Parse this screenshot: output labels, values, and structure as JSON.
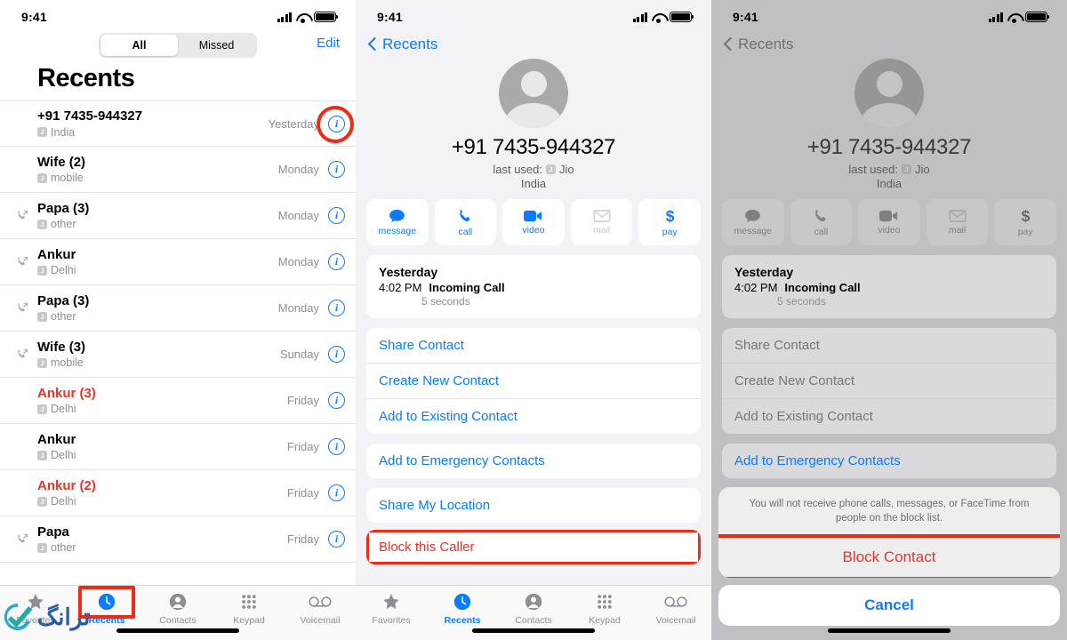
{
  "statusbar": {
    "time": "9:41",
    "signal_icon": "cellular-bars-icon",
    "wifi_icon": "wifi-icon",
    "battery_icon": "battery-icon"
  },
  "colors": {
    "accent_blue": "#0a7cff",
    "destructive_red": "#e8352a",
    "highlight_red": "#ee2b14",
    "grouped_bg": "#f2f2f7"
  },
  "panel1": {
    "segmented": {
      "options": [
        "All",
        "Missed"
      ],
      "selected": "All"
    },
    "edit_label": "Edit",
    "title": "Recents",
    "rows": [
      {
        "name": "+91 7435-944327",
        "sim": "J",
        "sub": "India",
        "time": "Yesterday",
        "missed": false,
        "direction": "none",
        "highlighted": true
      },
      {
        "name": "Wife (2)",
        "sim": "J",
        "sub": "mobile",
        "time": "Monday",
        "missed": false,
        "direction": "none",
        "highlighted": false
      },
      {
        "name": "Papa (3)",
        "sim": "J",
        "sub": "other",
        "time": "Monday",
        "missed": false,
        "direction": "outgoing",
        "highlighted": false
      },
      {
        "name": "Ankur",
        "sim": "J",
        "sub": "Delhi",
        "time": "Monday",
        "missed": false,
        "direction": "outgoing",
        "highlighted": false
      },
      {
        "name": "Papa (3)",
        "sim": "J",
        "sub": "other",
        "time": "Monday",
        "missed": false,
        "direction": "outgoing",
        "highlighted": false
      },
      {
        "name": "Wife (3)",
        "sim": "J",
        "sub": "mobile",
        "time": "Sunday",
        "missed": false,
        "direction": "outgoing",
        "highlighted": false
      },
      {
        "name": "Ankur (3)",
        "sim": "J",
        "sub": "Delhi",
        "time": "Friday",
        "missed": true,
        "direction": "none",
        "highlighted": false
      },
      {
        "name": "Ankur",
        "sim": "J",
        "sub": "Delhi",
        "time": "Friday",
        "missed": false,
        "direction": "none",
        "highlighted": false
      },
      {
        "name": "Ankur (2)",
        "sim": "J",
        "sub": "Delhi",
        "time": "Friday",
        "missed": true,
        "direction": "none",
        "highlighted": false
      },
      {
        "name": "Papa",
        "sim": "J",
        "sub": "other",
        "time": "Friday",
        "missed": false,
        "direction": "outgoing",
        "highlighted": false
      }
    ],
    "info_button_icon": "info-circle-icon",
    "watermark": {
      "text": "ترانگ",
      "logo_icon": "check-swoosh-logo-icon"
    }
  },
  "tabbar": {
    "items": [
      {
        "label": "Favorites",
        "icon": "star-icon",
        "active": false
      },
      {
        "label": "Recents",
        "icon": "clock-icon",
        "active": true
      },
      {
        "label": "Contacts",
        "icon": "person-icon",
        "active": false
      },
      {
        "label": "Keypad",
        "icon": "keypad-icon",
        "active": false
      },
      {
        "label": "Voicemail",
        "icon": "voicemail-icon",
        "active": false
      }
    ],
    "highlighted_item": "Recents"
  },
  "detail": {
    "back_label": "Recents",
    "back_icon": "chevron-left-icon",
    "avatar_icon": "person-placeholder-avatar",
    "number": "+91 7435-944327",
    "last_used_label": "last used:",
    "sim_badge": "J",
    "carrier": "Jio",
    "region": "India",
    "actions": [
      {
        "label": "message",
        "icon": "message-bubble-icon",
        "disabled": false
      },
      {
        "label": "call",
        "icon": "phone-icon",
        "disabled": false
      },
      {
        "label": "video",
        "icon": "video-camera-icon",
        "disabled": false
      },
      {
        "label": "mail",
        "icon": "envelope-icon",
        "disabled": true
      },
      {
        "label": "pay",
        "icon": "dollar-sign-icon",
        "disabled": false
      }
    ],
    "history": {
      "day": "Yesterday",
      "time": "4:02 PM",
      "type": "Incoming Call",
      "duration": "5 seconds"
    },
    "menu_group_1": [
      "Share Contact",
      "Create New Contact",
      "Add to Existing Contact"
    ],
    "menu_group_2": [
      "Add to Emergency Contacts"
    ],
    "menu_group_3": [
      "Share My Location"
    ],
    "menu_group_4": [
      "Block this Caller"
    ],
    "highlighted_menu_item": "Block this Caller"
  },
  "sheet": {
    "message": "You will not receive phone calls, messages, or FaceTime from people on the block list.",
    "block_label": "Block Contact",
    "cancel_label": "Cancel",
    "highlighted_item": "Block Contact"
  }
}
